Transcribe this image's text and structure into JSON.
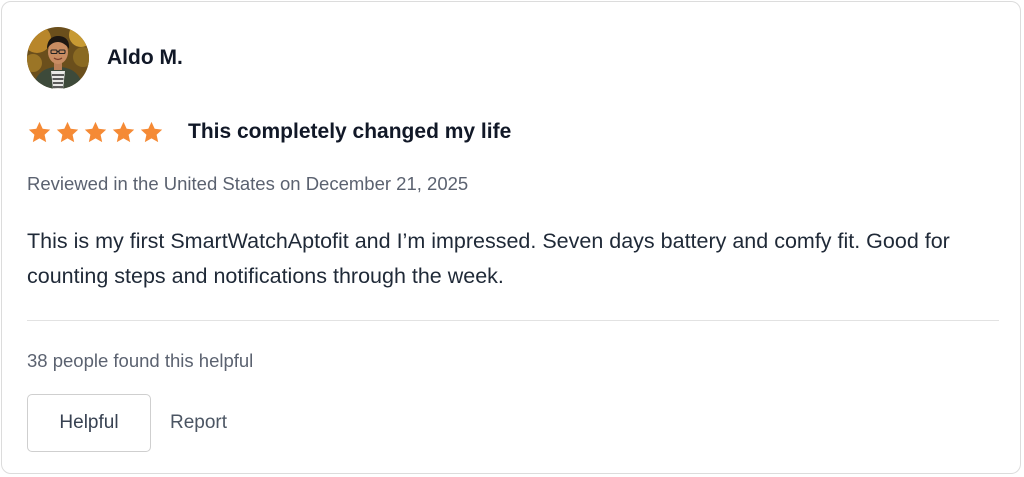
{
  "review": {
    "reviewer_name": "Aldo M.",
    "avatar_icon": "reviewer-avatar-photo",
    "rating": 5,
    "rating_max": 5,
    "star_color": "#f58a35",
    "title": "This completely changed my life",
    "meta": "Reviewed in the United States on December 21, 2025",
    "body": "This is my first SmartWatchAptofit and I’m impressed. Seven days battery and comfy fit. Good for counting steps and notifications through the week.",
    "helpful_count_text": "38 people found this helpful",
    "helpful_button_label": "Helpful",
    "report_label": "Report"
  }
}
